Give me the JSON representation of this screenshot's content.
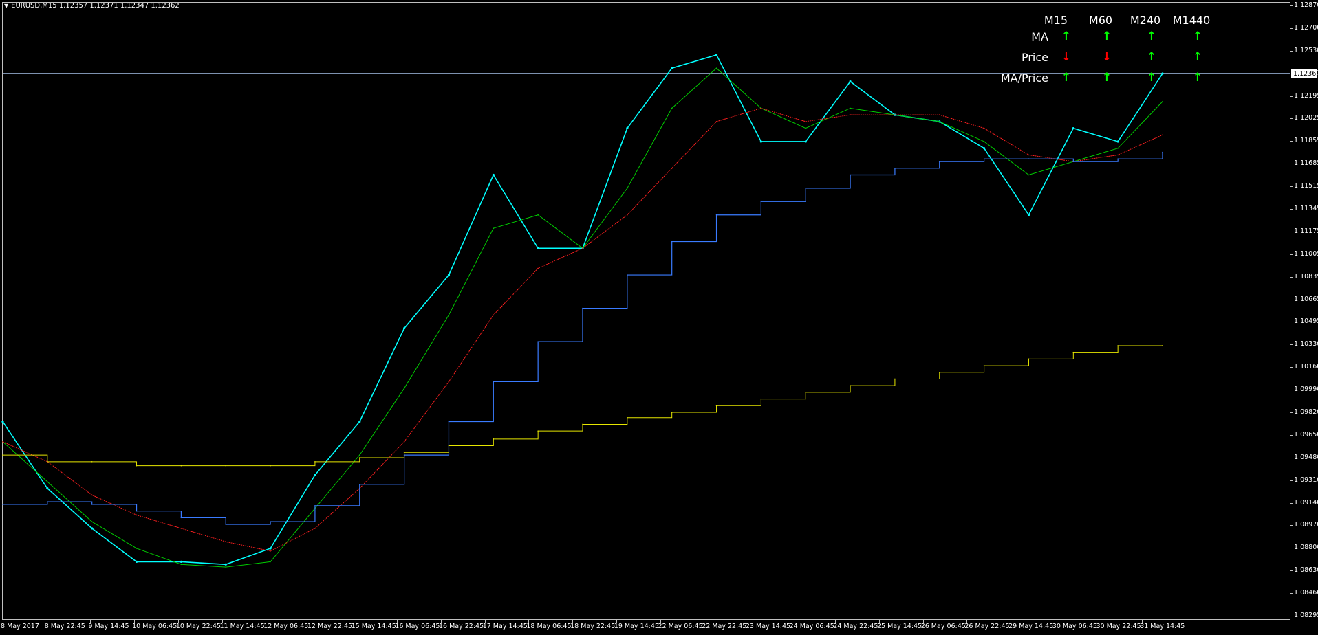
{
  "header": {
    "symbol_line": "EURUSD,M15  1.12357 1.12371 1.12347 1.12362"
  },
  "price_axis": {
    "labels": [
      "1.12870",
      "1.12700",
      "1.12530",
      "1.12362",
      "1.12195",
      "1.12025",
      "1.11855",
      "1.11685",
      "1.11515",
      "1.11345",
      "1.11175",
      "1.11005",
      "1.10835",
      "1.10665",
      "1.10495",
      "1.10330",
      "1.10160",
      "1.09990",
      "1.09820",
      "1.09650",
      "1.09480",
      "1.09310",
      "1.09140",
      "1.08970",
      "1.08800",
      "1.08630",
      "1.08460",
      "1.08295"
    ],
    "current_price": "1.12362"
  },
  "time_axis": {
    "labels": [
      "8 May 2017",
      "8 May 22:45",
      "9 May 14:45",
      "10 May 06:45",
      "10 May 22:45",
      "11 May 14:45",
      "12 May 06:45",
      "12 May 22:45",
      "15 May 14:45",
      "16 May 06:45",
      "16 May 22:45",
      "17 May 14:45",
      "18 May 06:45",
      "18 May 22:45",
      "19 May 14:45",
      "22 May 06:45",
      "22 May 22:45",
      "23 May 14:45",
      "24 May 06:45",
      "24 May 22:45",
      "25 May 14:45",
      "26 May 06:45",
      "26 May 22:45",
      "29 May 14:45",
      "30 May 06:45",
      "30 May 22:45",
      "31 May 14:45"
    ]
  },
  "signal_panel": {
    "columns": [
      "M15",
      "M60",
      "M240",
      "M1440"
    ],
    "rows": [
      {
        "label": "MA",
        "signals": [
          "up",
          "up",
          "up",
          "up"
        ]
      },
      {
        "label": "Price",
        "signals": [
          "down",
          "down",
          "up",
          "up"
        ]
      },
      {
        "label": "MA/Price",
        "signals": [
          "up",
          "up",
          "up",
          "up"
        ]
      }
    ],
    "up_glyph": "🡑",
    "down_glyph": "🡓"
  },
  "colors": {
    "candles": "#00ffff",
    "ma_fast": "#00cc00",
    "ma_mid": "#ff2020",
    "ma_slow": "#3a7bff",
    "ma_daily": "#e6e600",
    "current_line": "#8fa6c8",
    "up": "#00ff00",
    "down": "#ff0000"
  },
  "chart_data": {
    "type": "line",
    "title": "EURUSD,M15",
    "ylim": [
      1.08295,
      1.1287
    ],
    "x": [
      "8 May 2017",
      "8 May 22:45",
      "9 May 14:45",
      "10 May 06:45",
      "10 May 22:45",
      "11 May 14:45",
      "12 May 06:45",
      "12 May 22:45",
      "15 May 14:45",
      "16 May 06:45",
      "16 May 22:45",
      "17 May 14:45",
      "18 May 06:45",
      "18 May 22:45",
      "19 May 14:45",
      "22 May 06:45",
      "22 May 22:45",
      "23 May 14:45",
      "24 May 06:45",
      "24 May 22:45",
      "25 May 14:45",
      "26 May 06:45",
      "26 May 22:45",
      "29 May 14:45",
      "30 May 06:45",
      "30 May 22:45",
      "31 May 14:45"
    ],
    "series": [
      {
        "values": [
          1.0975,
          1.0925,
          1.0895,
          1.087,
          1.087,
          1.0868,
          1.088,
          1.0935,
          1.0975,
          1.1045,
          1.1085,
          1.116,
          1.1105,
          1.1105,
          1.1195,
          1.124,
          1.125,
          1.1185,
          1.1185,
          1.123,
          1.1205,
          1.12,
          1.118,
          1.113,
          1.1195,
          1.1185,
          1.1236
        ]
      },
      {
        "values": [
          1.096,
          1.093,
          1.09,
          1.088,
          1.0868,
          1.0866,
          1.087,
          1.091,
          1.095,
          1.1,
          1.1055,
          1.112,
          1.113,
          1.1105,
          1.115,
          1.121,
          1.124,
          1.121,
          1.1195,
          1.121,
          1.1205,
          1.12,
          1.1185,
          1.116,
          1.117,
          1.118,
          1.1215
        ]
      },
      {
        "values": [
          1.096,
          1.0945,
          1.092,
          1.0905,
          1.0895,
          1.0885,
          1.0878,
          1.0895,
          1.0925,
          1.096,
          1.1005,
          1.1055,
          1.109,
          1.1105,
          1.113,
          1.1165,
          1.12,
          1.121,
          1.12,
          1.1205,
          1.1205,
          1.1205,
          1.1195,
          1.1175,
          1.117,
          1.1175,
          1.119
        ]
      },
      {
        "values": [
          1.0913,
          1.0915,
          1.0913,
          1.0908,
          1.0903,
          1.0898,
          1.09,
          1.0912,
          1.0928,
          1.095,
          1.0975,
          1.1005,
          1.1035,
          1.106,
          1.1085,
          1.111,
          1.113,
          1.114,
          1.115,
          1.116,
          1.1165,
          1.117,
          1.1172,
          1.1172,
          1.117,
          1.1172,
          1.1177
        ]
      },
      {
        "values": [
          1.095,
          1.0945,
          1.0945,
          1.0942,
          1.0942,
          1.0942,
          1.0942,
          1.0945,
          1.0948,
          1.0952,
          1.0957,
          1.0962,
          1.0968,
          1.0973,
          1.0978,
          1.0982,
          1.0987,
          1.0992,
          1.0997,
          1.1002,
          1.1007,
          1.1012,
          1.1017,
          1.1022,
          1.1027,
          1.1032,
          1.1032
        ]
      }
    ]
  }
}
